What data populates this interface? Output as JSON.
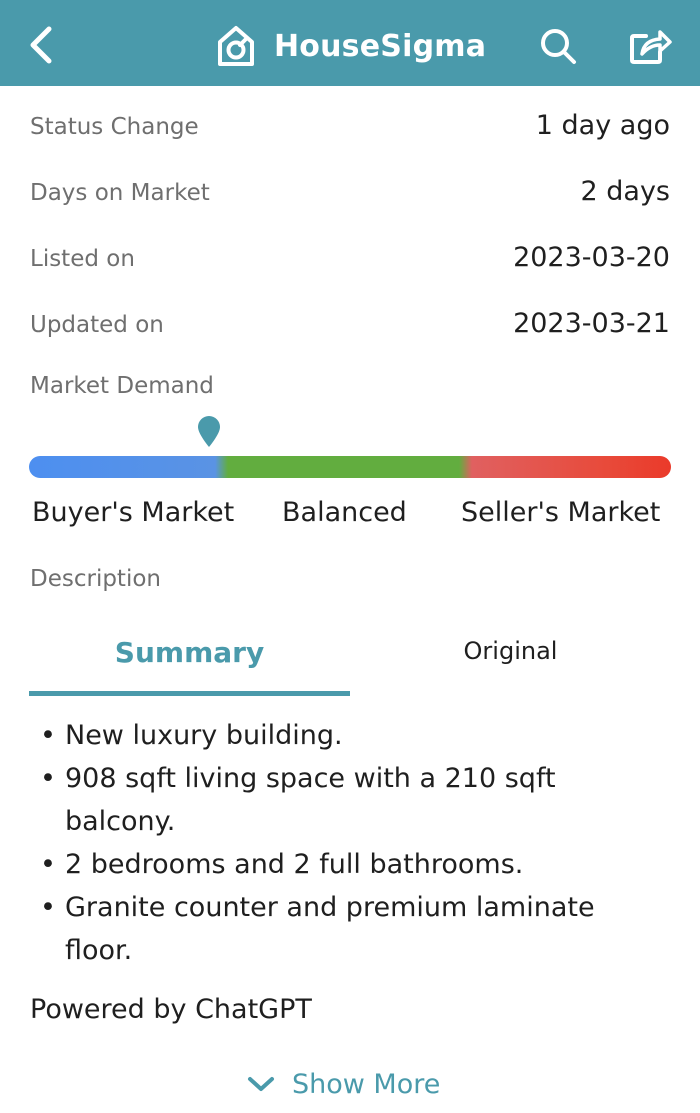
{
  "header": {
    "brand_name": "HouseSigma",
    "brand_color": "#4a9aab",
    "icons": [
      "chevron-left-icon",
      "housesigma-logo",
      "search-icon",
      "share-icon"
    ]
  },
  "details": [
    {
      "label": "Status Change",
      "value": "1 day ago"
    },
    {
      "label": "Days on Market",
      "value": "2 days"
    },
    {
      "label": "Listed on",
      "value": "2023-03-20"
    },
    {
      "label": "Updated on",
      "value": "2023-03-21"
    }
  ],
  "market_demand": {
    "title": "Market Demand",
    "indicator_position": 0.28,
    "labels": [
      "Buyer's Market",
      "Balanced",
      "Seller's Market"
    ],
    "colors": {
      "buyer": "#4d8ff0",
      "balanced": "#62ad3f",
      "seller": "#e84a3a"
    }
  },
  "description": {
    "title": "Description",
    "tabs": [
      {
        "label": "Summary",
        "active": true
      },
      {
        "label": "Original",
        "active": false
      }
    ],
    "bullets": [
      "New luxury building.",
      "908 sqft living space with a 210 sqft balcony.",
      "2 bedrooms and 2 full bathrooms.",
      "Granite counter and premium laminate floor."
    ],
    "powered_by": "Powered by ChatGPT",
    "show_more": "Show More"
  }
}
